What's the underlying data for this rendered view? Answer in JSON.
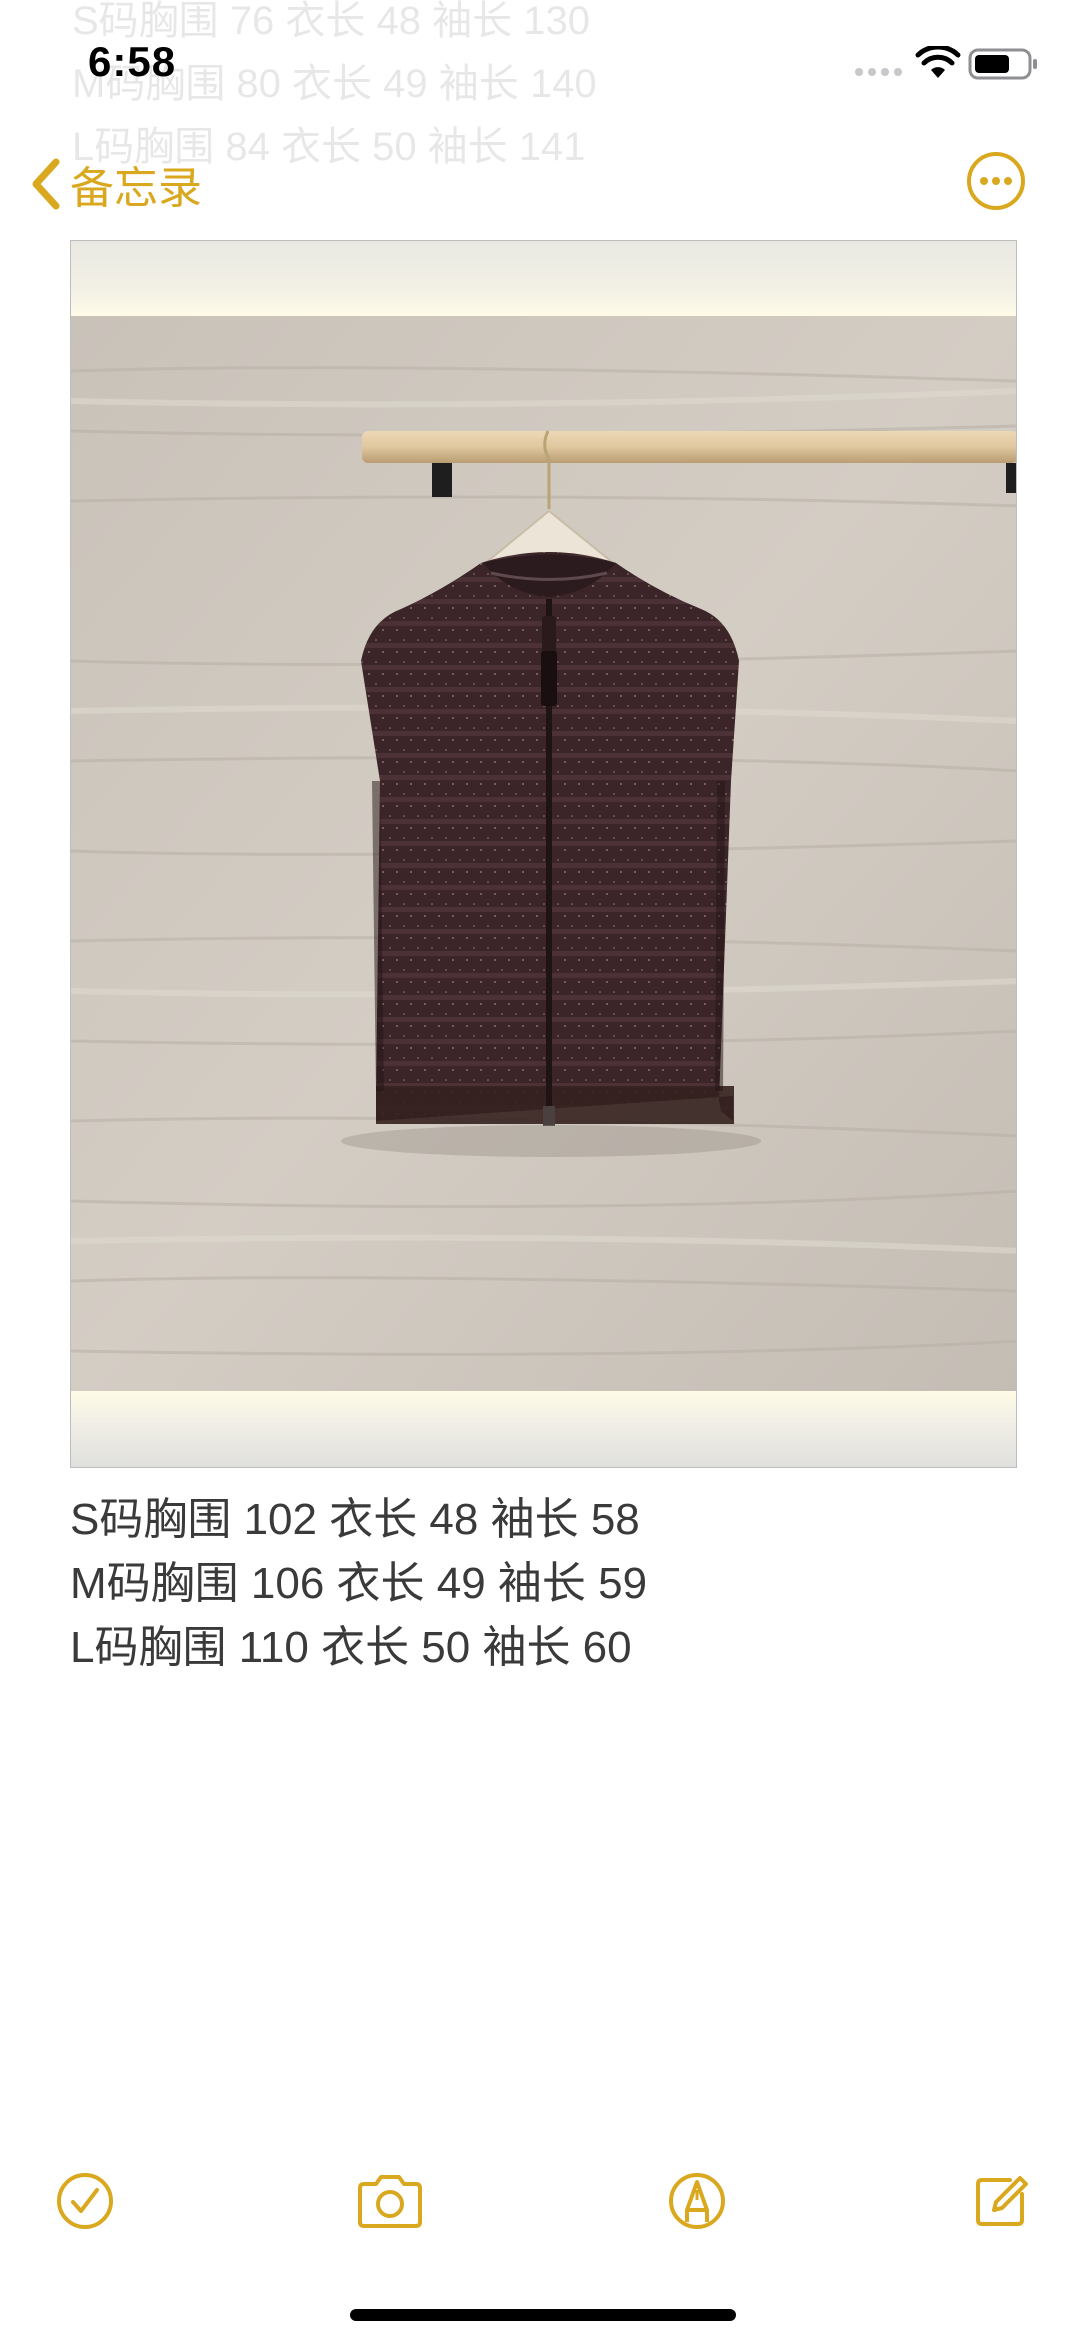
{
  "status_bar": {
    "time": "6:58"
  },
  "ghost_lines": [
    "S码胸围 76 衣长 48 袖长 130",
    "M码胸围 80 衣长 49 袖长 140",
    "L码胸围 84 衣长 50 袖长 141"
  ],
  "nav": {
    "back_label": "备忘录",
    "back_icon": "chevron-left-icon",
    "more_icon": "ellipsis-circle-icon"
  },
  "note": {
    "lines": [
      "S码胸围 102 衣长 48 袖长 58",
      "M码胸围 106 衣长 49 袖长 59",
      "L码胸围 110 衣长 50 袖长 60"
    ]
  },
  "toolbar": {
    "items": [
      {
        "icon": "checklist-icon"
      },
      {
        "icon": "camera-icon"
      },
      {
        "icon": "markup-pen-icon"
      },
      {
        "icon": "compose-icon"
      }
    ]
  },
  "colors": {
    "accent": "#d9a81e",
    "text": "#3a3a3a",
    "garment": "#3b2528"
  }
}
